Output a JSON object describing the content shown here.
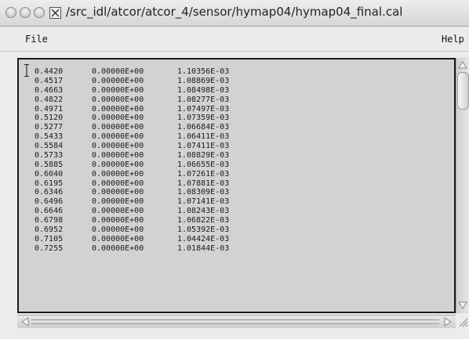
{
  "window": {
    "title": "/src_idl/atcor/atcor_4/sensor/hymap04/hymap04_final.cal"
  },
  "menu": {
    "file_label": "File",
    "help_label": "Help"
  },
  "data_rows": [
    [
      "0.4420",
      "0.00000E+00",
      "1.10356E-03"
    ],
    [
      "0.4517",
      "0.00000E+00",
      "1.08869E-03"
    ],
    [
      "0.4663",
      "0.00000E+00",
      "1.08498E-03"
    ],
    [
      "0.4822",
      "0.00000E+00",
      "1.08277E-03"
    ],
    [
      "0.4971",
      "0.00000E+00",
      "1.07497E-03"
    ],
    [
      "0.5120",
      "0.00000E+00",
      "1.07359E-03"
    ],
    [
      "0.5277",
      "0.00000E+00",
      "1.06684E-03"
    ],
    [
      "0.5433",
      "0.00000E+00",
      "1.06411E-03"
    ],
    [
      "0.5584",
      "0.00000E+00",
      "1.07411E-03"
    ],
    [
      "0.5733",
      "0.00000E+00",
      "1.08829E-03"
    ],
    [
      "0.5885",
      "0.00000E+00",
      "1.06655E-03"
    ],
    [
      "0.6040",
      "0.00000E+00",
      "1.07261E-03"
    ],
    [
      "0.6195",
      "0.00000E+00",
      "1.07881E-03"
    ],
    [
      "0.6346",
      "0.00000E+00",
      "1.08309E-03"
    ],
    [
      "0.6496",
      "0.00000E+00",
      "1.07141E-03"
    ],
    [
      "0.6646",
      "0.00000E+00",
      "1.08243E-03"
    ],
    [
      "0.6798",
      "0.00000E+00",
      "1.06822E-03"
    ],
    [
      "0.6952",
      "0.00000E+00",
      "1.05392E-03"
    ],
    [
      "0.7105",
      "0.00000E+00",
      "1.04424E-03"
    ],
    [
      "0.7255",
      "0.00000E+00",
      "1.01844E-03"
    ]
  ],
  "icons": {
    "close": "circle-button-icon",
    "minimize": "circle-button-icon",
    "zoom": "circle-button-icon",
    "x_window": "x-window-icon",
    "text_cursor": "i-beam-cursor-icon",
    "scroll_up": "triangle-up-icon",
    "scroll_down": "triangle-down-icon",
    "scroll_left": "triangle-left-icon",
    "scroll_right": "triangle-right-icon",
    "resize": "resize-grip-icon"
  },
  "colors": {
    "window_bg": "#ececec",
    "text_area_bg": "#d2d2d2",
    "text_color": "#1b1b1b"
  }
}
